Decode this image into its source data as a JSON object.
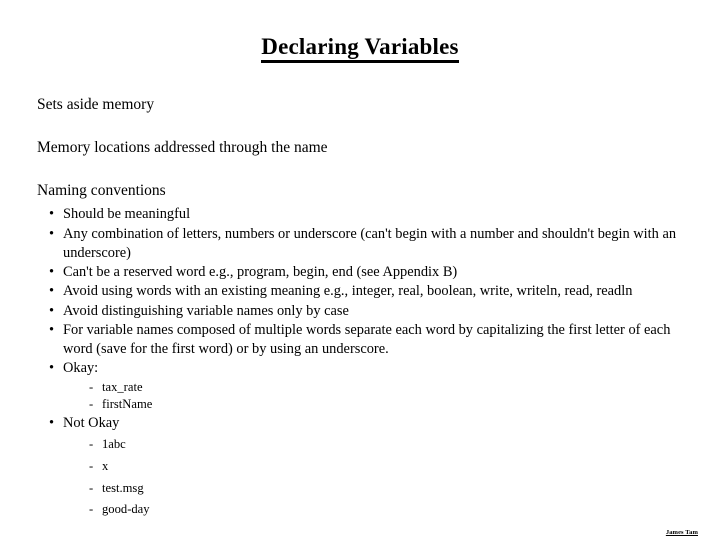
{
  "slide": {
    "title": "Declaring Variables",
    "statements": [
      "Sets aside memory",
      "Memory locations addressed through the name",
      "Naming conventions"
    ],
    "bullet_marker": "•",
    "sub_marker": "-",
    "bullets": [
      {
        "text": "Should be meaningful"
      },
      {
        "text": "Any combination of letters, numbers or underscore (can't begin with a number and shouldn't begin with an underscore)"
      },
      {
        "text": "Can't be a reserved word e.g., program, begin, end (see Appendix B)"
      },
      {
        "text": "Avoid using words with an existing meaning e.g., integer, real, boolean, write, writeln, read, readln"
      },
      {
        "text": "Avoid distinguishing variable names only by case"
      },
      {
        "text": "For variable names composed of multiple words separate each word by capitalizing the first letter of each word (save for the first word) or by using an underscore."
      },
      {
        "text": "Okay:",
        "sub": [
          "tax_rate",
          "firstName"
        ]
      },
      {
        "text": "Not Okay",
        "sub": [
          "1abc",
          "x",
          "test.msg",
          "good-day"
        ]
      }
    ]
  },
  "credit": "James Tam"
}
